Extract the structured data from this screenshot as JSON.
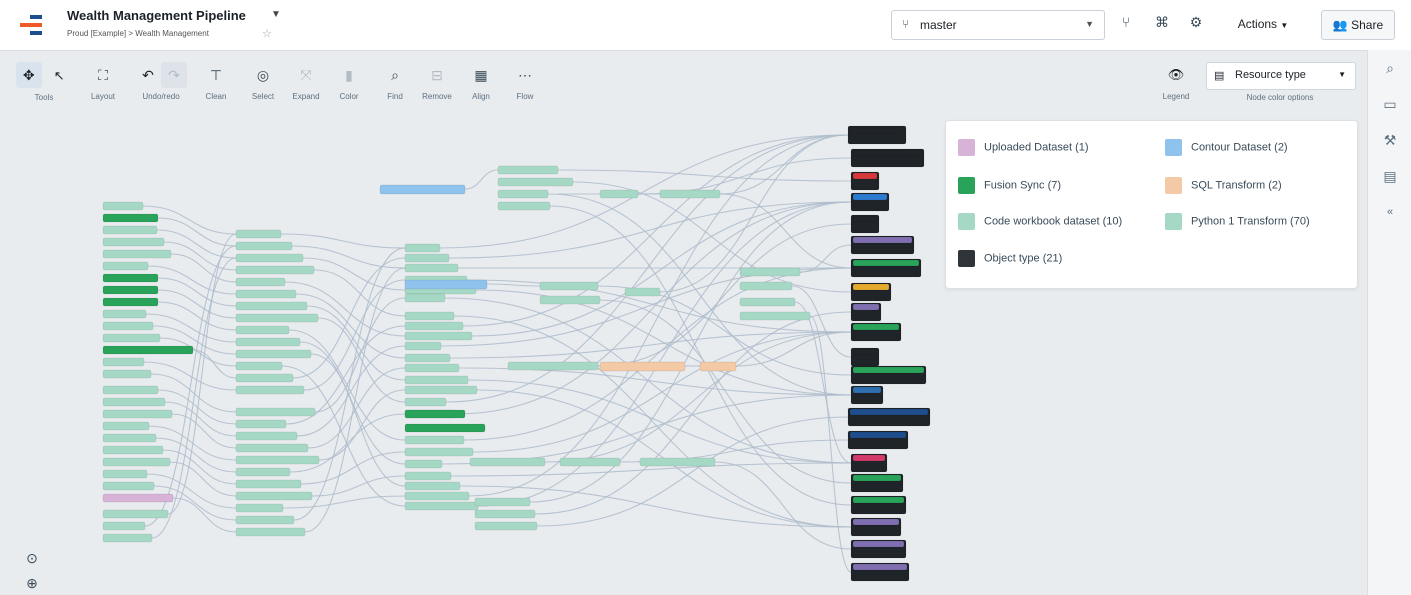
{
  "header": {
    "title": "Wealth Management Pipeline",
    "breadcrumb": "Proud [Example] > Wealth Management",
    "branch": "master",
    "actions_label": "Actions",
    "share_label": "Share"
  },
  "toolbar": {
    "tools": [
      {
        "label": "Tools"
      },
      {
        "label": "Layout"
      },
      {
        "label": "Undo/redo"
      },
      {
        "label": "Clean"
      },
      {
        "label": "Select"
      },
      {
        "label": "Expand"
      },
      {
        "label": "Color"
      },
      {
        "label": "Find"
      },
      {
        "label": "Remove"
      },
      {
        "label": "Align"
      },
      {
        "label": "Flow"
      }
    ],
    "legend_label": "Legend",
    "resource_type": "Resource type",
    "resource_type_caption": "Node color options"
  },
  "legend": {
    "items": [
      {
        "label": "Uploaded Dataset (1)",
        "color": "#d7b3d8"
      },
      {
        "label": "Contour Dataset (2)",
        "color": "#8fc3ee"
      },
      {
        "label": "Fusion Sync (7)",
        "color": "#2aa35a"
      },
      {
        "label": "SQL Transform (2)",
        "color": "#f4c9a6"
      },
      {
        "label": "Code workbook dataset (10)",
        "color": "#a6d8c6"
      },
      {
        "label": "Python 1 Transform (70)",
        "color": "#a6d8c6"
      },
      {
        "label": "Object type (21)",
        "color": "#2f3438"
      }
    ]
  },
  "colors": {
    "code": "#a6d8c6",
    "fusion": "#2aa35a",
    "uploaded": "#d7b3d8",
    "contour": "#8fc3ee",
    "sql": "#f4c9a6",
    "object": "#1f2428",
    "edge": "#aebccb",
    "brand_orange": "#f05a28"
  }
}
